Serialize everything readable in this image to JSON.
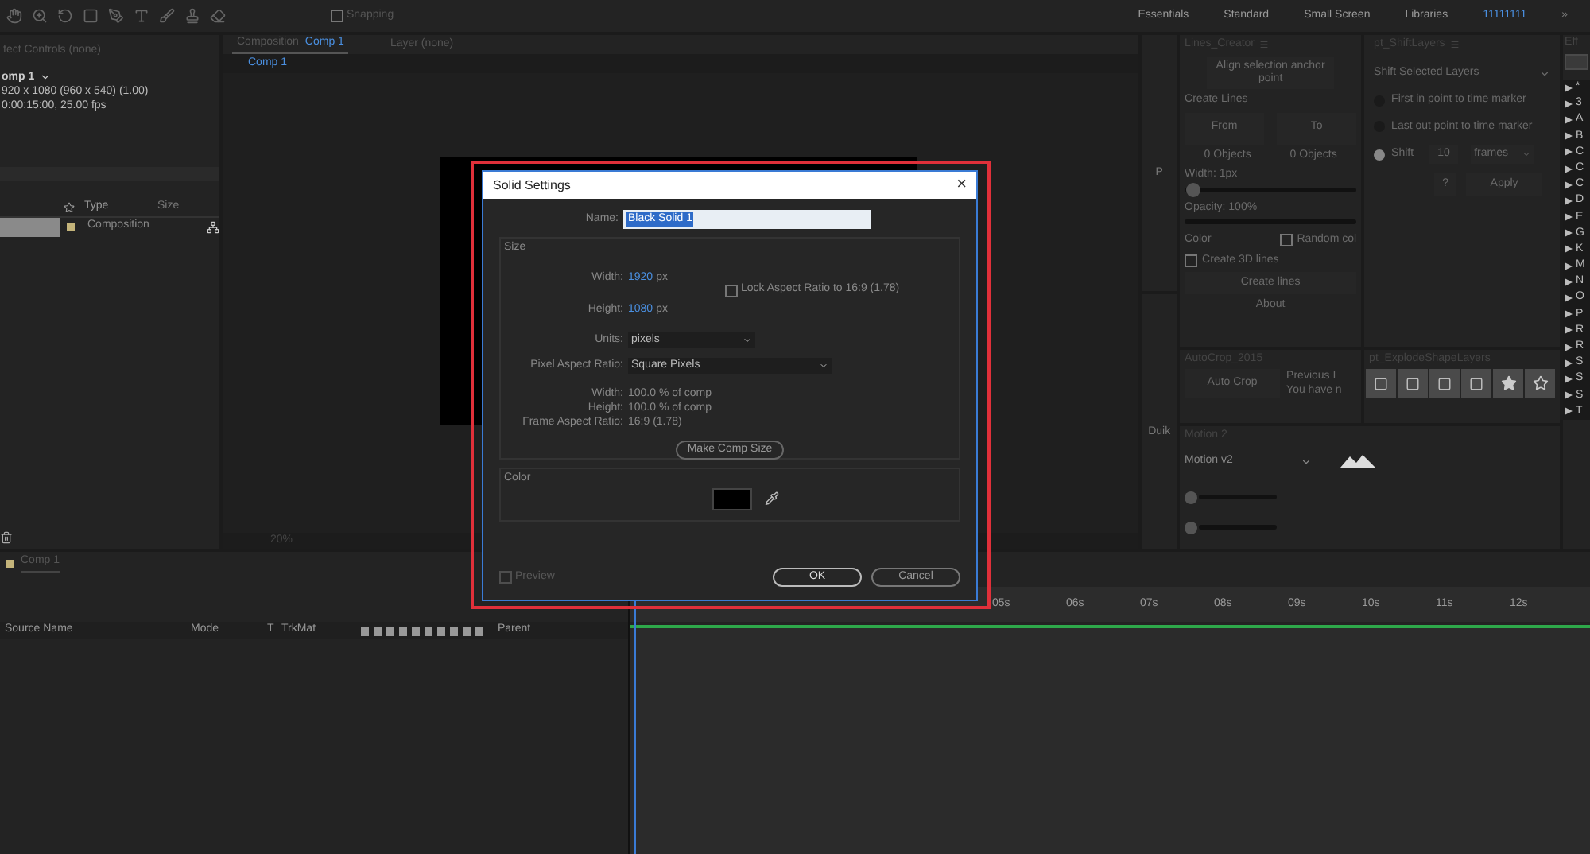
{
  "toolbar": {
    "snapping": {
      "label": "Snapping",
      "checked": false
    },
    "workspaces": [
      {
        "label": "Essentials",
        "selected": false
      },
      {
        "label": "Standard",
        "selected": false
      },
      {
        "label": "Small Screen",
        "selected": false
      },
      {
        "label": "Libraries",
        "selected": false
      },
      {
        "label": "11111111",
        "selected": true
      }
    ],
    "overflow": "»"
  },
  "project_panel": {
    "title": "fect Controls (none)",
    "comp_name": "omp 1",
    "comp_size": "920 x 1080  (960 x 540) (1.00)",
    "comp_duration": "0:00:15:00, 25.00 fps",
    "columns": [
      "Type",
      "Size"
    ],
    "rows": [
      {
        "type": "Composition",
        "selected": true
      }
    ]
  },
  "composition_panel": {
    "tabs": [
      {
        "label": "Composition",
        "name": "Comp 1",
        "selected": true
      },
      {
        "label": "Layer (none)",
        "selected": false
      }
    ],
    "breadcrumb": "Comp 1",
    "zoom": "20%"
  },
  "side_strip": {
    "items": [
      "P",
      "Duik"
    ]
  },
  "lines_creator": {
    "title": "Lines_Creator",
    "align_button": "Align selection anchor point",
    "create_label": "Create Lines",
    "from_button": "From",
    "to_button": "To",
    "from_count": "0 Objects",
    "to_count": "0 Objects",
    "width_label": "Width: 1px",
    "width_slider": {
      "level": 0.05
    },
    "opacity_label": "Opacity: 100%",
    "color_label": "Color",
    "random_color": {
      "label": "Random col",
      "checked": false
    },
    "create_3d": {
      "label": "Create 3D lines",
      "checked": false
    },
    "create_button": "Create lines",
    "about": "About"
  },
  "shift_layers": {
    "title": "pt_ShiftLayers",
    "mode": "Shift Selected Layers",
    "options": [
      {
        "label": "First in point to time marker",
        "selected": false
      },
      {
        "label": "Last out point to time marker",
        "selected": false
      },
      {
        "label": "Shift",
        "selected": true
      }
    ],
    "amount": "10",
    "unit": "frames",
    "help": "?",
    "apply": "Apply"
  },
  "autocrop": {
    "title": "AutoCrop_2015",
    "button": "Auto Crop",
    "lines": [
      "Previous I",
      "You have n"
    ]
  },
  "explode": {
    "title": "pt_ExplodeShapeLayers"
  },
  "motion": {
    "title": "Motion 2",
    "preset": "Motion v2"
  },
  "effects": {
    "title": "Eff",
    "items": [
      "*",
      "3",
      "A",
      "B",
      "C",
      "C",
      "C",
      "D",
      "E",
      "G",
      "K",
      "M",
      "N",
      "O",
      "P",
      "R",
      "R",
      "S",
      "S",
      "S",
      "T"
    ]
  },
  "timeline": {
    "tab": "Comp 1",
    "columns": [
      "Source Name",
      "Mode",
      "T",
      "TrkMat",
      "Parent"
    ],
    "ruler": [
      "05s",
      "06s",
      "07s",
      "08s",
      "09s",
      "10s",
      "11s",
      "12s"
    ]
  },
  "dialog": {
    "title": "Solid Settings",
    "close": "×",
    "name_label": "Name:",
    "name_value": "Black Solid 1",
    "size_title": "Size",
    "width_label": "Width:",
    "width_value": "1920",
    "height_label": "Height:",
    "height_value": "1080",
    "width_unit": "px",
    "height_unit": "px",
    "lock": {
      "label": "Lock Aspect Ratio to 16:9 (1.78)",
      "checked": false
    },
    "units_label": "Units:",
    "units_value": "pixels",
    "par_label": "Pixel Aspect Ratio:",
    "par_value": "Square Pixels",
    "info": [
      {
        "label": "Width:",
        "value": "100.0 % of comp"
      },
      {
        "label": "Height:",
        "value": "100.0 % of comp"
      },
      {
        "label": "Frame Aspect Ratio:",
        "value": "16:9 (1.78)"
      }
    ],
    "make_comp_size": "Make Comp Size",
    "color_title": "Color",
    "color": "#000000",
    "preview": {
      "label": "Preview",
      "checked": false
    },
    "ok": "OK",
    "cancel": "Cancel"
  }
}
